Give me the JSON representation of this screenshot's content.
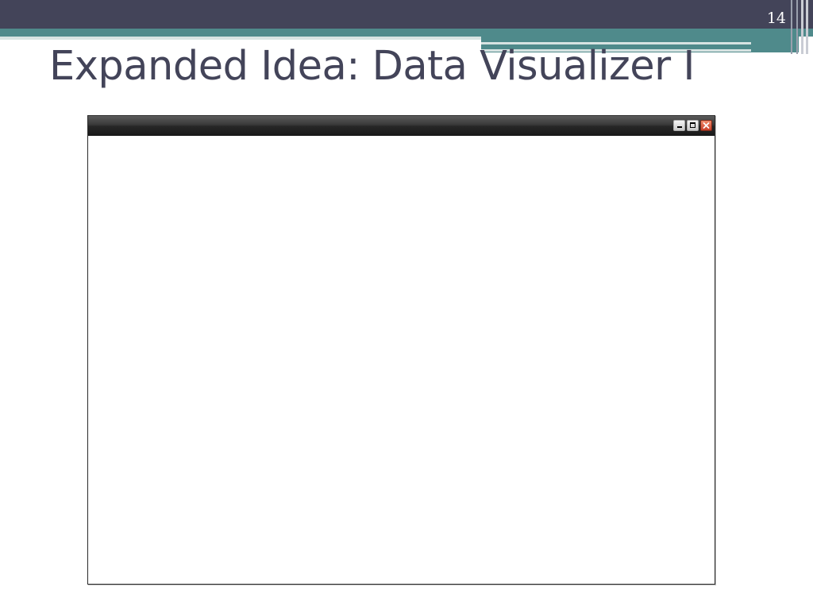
{
  "slide": {
    "number": "14",
    "title": "Expanded Idea: Data Visualizer I"
  },
  "theme": {
    "dark_band": "#434459",
    "teal_band": "#4f8a8b",
    "title_color": "#434459"
  },
  "window": {
    "controls": [
      {
        "icon": "minimize-icon"
      },
      {
        "icon": "maximize-icon"
      },
      {
        "icon": "close-icon",
        "color": "#d9482f"
      }
    ]
  }
}
